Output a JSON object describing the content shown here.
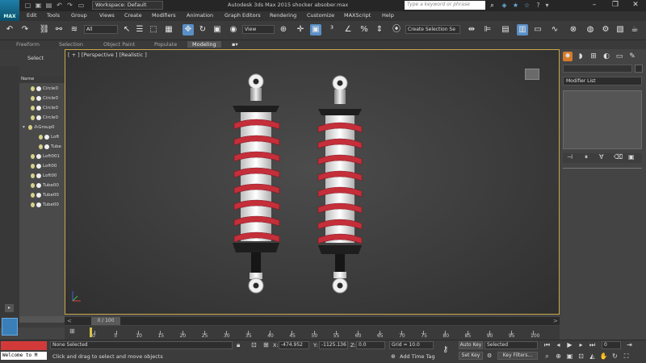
{
  "app": {
    "title": "Autodesk 3ds Max  2015",
    "file": "shocker absober.max",
    "icon_label": "MAX",
    "workspace": "Workspace: Default",
    "search_placeholder": "Type a keyword or phrase"
  },
  "menus": [
    "Edit",
    "Tools",
    "Group",
    "Views",
    "Create",
    "Modifiers",
    "Animation",
    "Graph Editors",
    "Rendering",
    "Customize",
    "MAXScript",
    "Help"
  ],
  "toolbar": {
    "selection_filter": "All",
    "ref_coord": "View",
    "named_selection": "Create Selection Se"
  },
  "ribbon_tabs": [
    "Freeform",
    "Selection",
    "Object Paint",
    "Populate",
    "Modeling"
  ],
  "ribbon_active": "Modeling",
  "left_panel": {
    "select_label": "Select",
    "name_header": "Name",
    "items": [
      "Circle0",
      "Circle0",
      "Circle0",
      "Circle0",
      "Group0",
      "Loft",
      "Tube",
      "Loft001",
      "Loft00",
      "Loft00",
      "Tube00",
      "Tube00",
      "Tube00"
    ]
  },
  "viewport": {
    "label": "[ + ] [Perspective ] [Realistic ]",
    "colors": {
      "spring": "#c42f3a",
      "shock_body": "#f2f2f2",
      "rubber": "#1c1c1c",
      "frame": "#c8a84a"
    }
  },
  "command_panel": {
    "modifier_list": "Modifier List"
  },
  "timeline": {
    "slider_label": "0 / 100",
    "ticks": [
      0,
      5,
      10,
      15,
      20,
      25,
      30,
      35,
      40,
      45,
      50,
      55,
      60,
      65,
      70,
      75,
      80,
      85,
      90,
      95,
      100
    ]
  },
  "status": {
    "welcome": "Welcome to M",
    "none_selected": "None Selected",
    "prompt": "Click and drag to select and move objects",
    "x_label": "X:",
    "x_value": "-474.952",
    "y_label": "Y:",
    "y_value": "-1125.136",
    "z_label": "Z:",
    "z_value": "0.0",
    "grid": "Grid = 10.0",
    "add_time_tag": "Add Time Tag",
    "auto_key": "Auto Key",
    "set_key": "Set Key",
    "key_mode": "Selected",
    "key_filters": "Key Filters...",
    "frame": "0"
  }
}
